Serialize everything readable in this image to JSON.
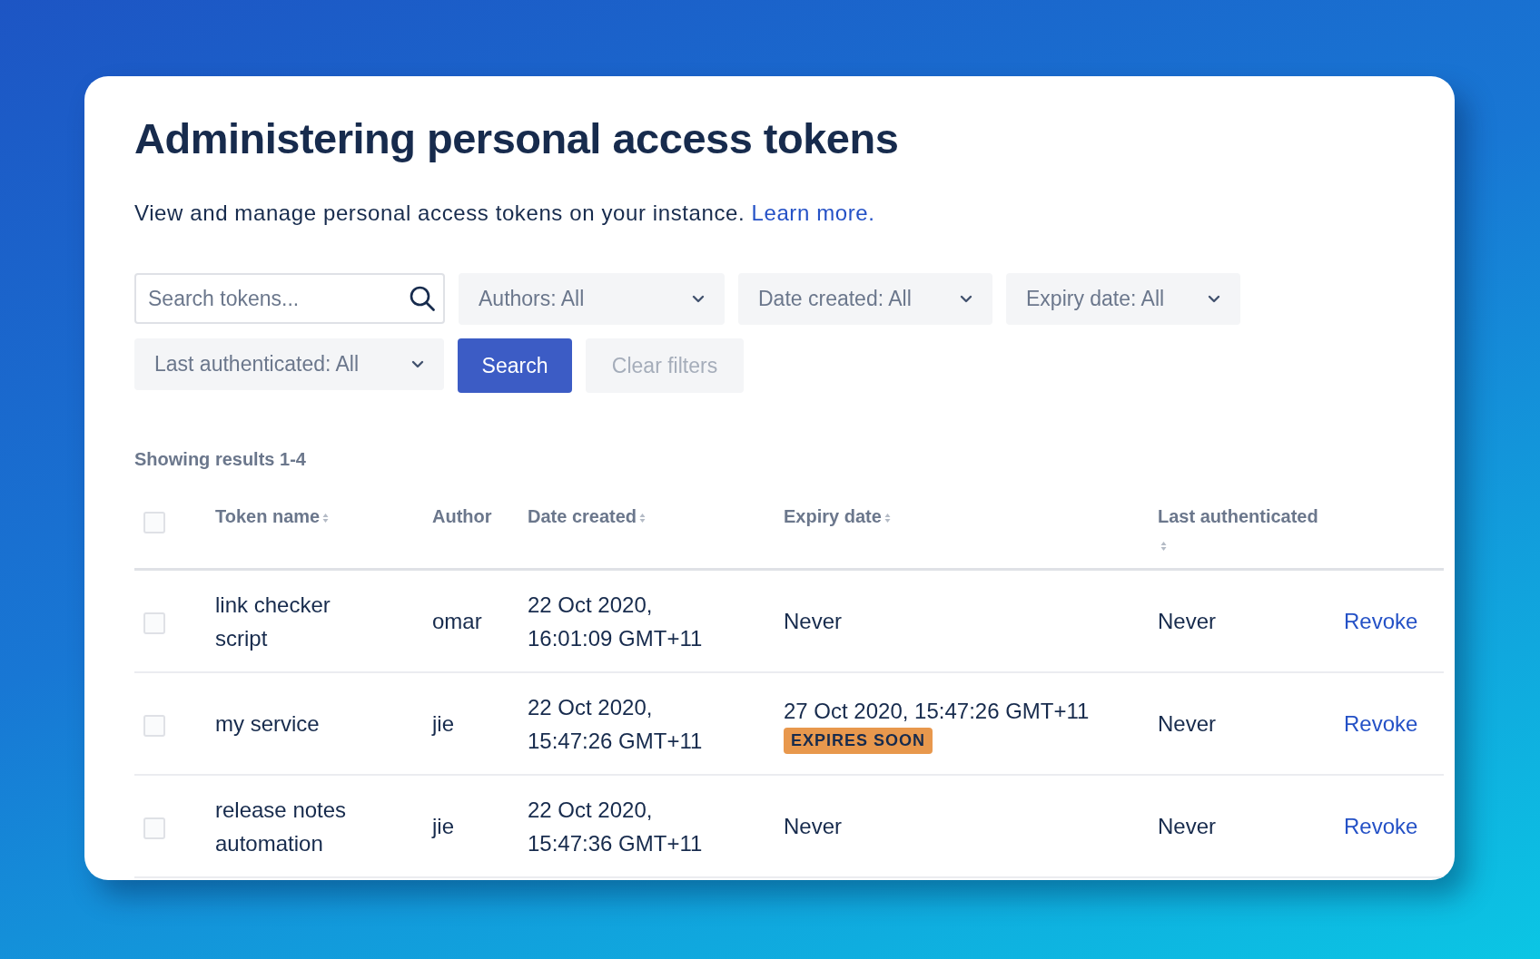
{
  "page": {
    "title": "Administering personal access tokens",
    "description": "View and manage personal access tokens on your instance.",
    "learn_more": "Learn more."
  },
  "filters": {
    "search": {
      "placeholder": "Search tokens..."
    },
    "dropdowns": [
      {
        "label": "Authors: All"
      },
      {
        "label": "Date created: All"
      },
      {
        "label": "Expiry date: All"
      },
      {
        "label": "Last authenticated: All"
      }
    ],
    "search_button": "Search",
    "clear_button": {
      "label": "Clear filters",
      "disabled": true
    }
  },
  "results": "Showing results 1-4",
  "table": {
    "select_all": {
      "checked": false
    },
    "columns": [
      {
        "label": "Token name",
        "sortable": true
      },
      {
        "label": "Author",
        "sortable": false
      },
      {
        "label": "Date created",
        "sortable": true
      },
      {
        "label": "Expiry date",
        "sortable": true
      },
      {
        "label": "Last authenticated",
        "sortable": true
      }
    ],
    "rows": [
      {
        "checked": false,
        "token_name": "link checker script",
        "author": "omar",
        "date_created": "22 Oct 2020, 16:01:09 GMT+11",
        "expiry_date": "Never",
        "last_authenticated": "Never",
        "action": "Revoke"
      },
      {
        "checked": false,
        "token_name": "my service",
        "author": "jie",
        "date_created": "22 Oct 2020, 15:47:26 GMT+11",
        "expiry_date": "27 Oct 2020, 15:47:26 GMT+11",
        "badge": "EXPIRES SOON",
        "last_authenticated": "Never",
        "action": "Revoke"
      },
      {
        "checked": false,
        "token_name": "release notes automation",
        "author": "jie",
        "date_created": "22 Oct 2020, 15:47:36 GMT+11",
        "expiry_date": "Never",
        "last_authenticated": "Never",
        "action": "Revoke"
      }
    ]
  }
}
